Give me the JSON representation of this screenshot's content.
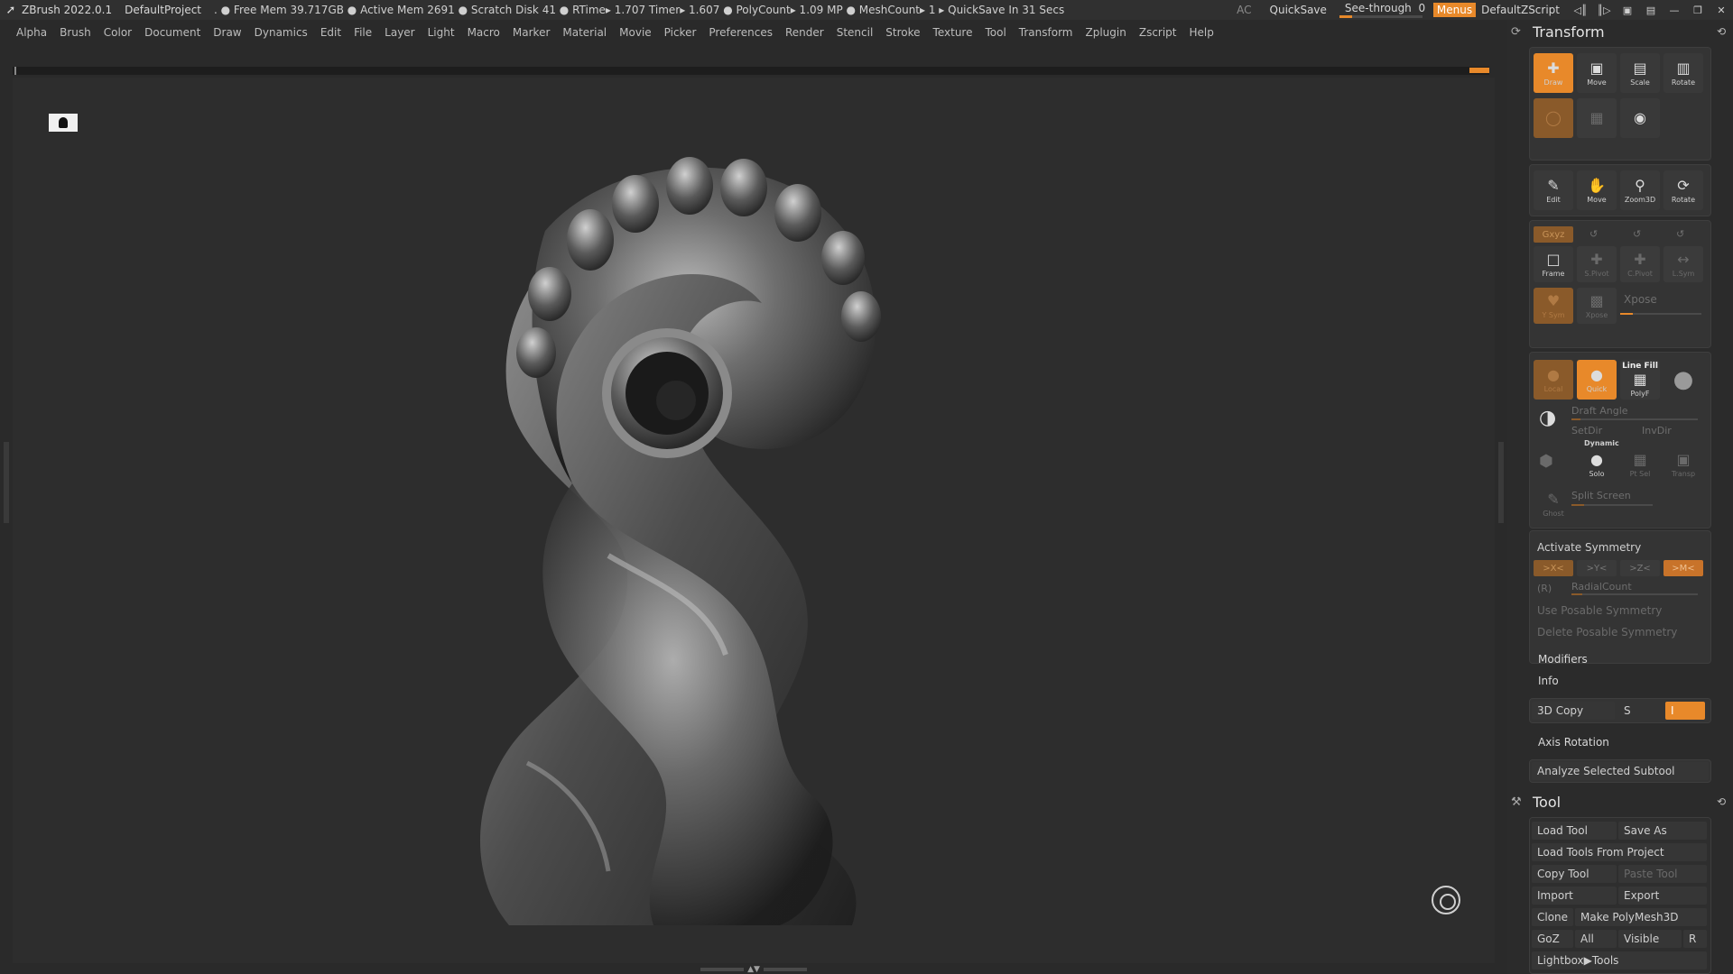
{
  "titlebar": {
    "app": "ZBrush 2022.0.1",
    "project": "DefaultProject",
    "stats": ". ● Free Mem 39.717GB ● Active Mem 2691 ● Scratch Disk 41 ●  RTime▸ 1.707 Timer▸ 1.607 ● PolyCount▸ 1.09 MP  ● MeshCount▸ 1  ▸ QuickSave In 31 Secs",
    "ac": "AC",
    "quicksave": "QuickSave",
    "seethrough_label": "See-through",
    "seethrough_value": "0",
    "seethrough_level": 0.15,
    "menus": "Menus",
    "script": "DefaultZScript"
  },
  "menubar": [
    "Alpha",
    "Brush",
    "Color",
    "Document",
    "Draw",
    "Dynamics",
    "Edit",
    "File",
    "Layer",
    "Light",
    "Macro",
    "Marker",
    "Material",
    "Movie",
    "Picker",
    "Preferences",
    "Render",
    "Stencil",
    "Stroke",
    "Texture",
    "Tool",
    "Transform",
    "Zplugin",
    "Zscript",
    "Help"
  ],
  "transform": {
    "title": "Transform",
    "modes": {
      "draw": "Draw",
      "move": "Move",
      "scale": "Scale",
      "rotate": "Rotate"
    },
    "nav": {
      "edit": "Edit",
      "move": "Move",
      "zoom3d": "Zoom3D",
      "rotate": "Rotate"
    },
    "xyz": "Gxyz",
    "frame": "Frame",
    "spivot": "S.Pivot",
    "cpivot": "C.Pivot",
    "lsym": "L.Sym",
    "ysym": "Y Sym",
    "xpose_btn": "Xpose",
    "xpose_label": "Xpose",
    "local": "Local",
    "quick": "Quick",
    "line_fill": "Line Fill",
    "polyf": "PolyF",
    "draft_angle": "Draft Angle",
    "setdir": "SetDir",
    "invdir": "InvDir",
    "dynamic": "Dynamic",
    "solo": "Solo",
    "ptsel": "Pt Sel",
    "transp": "Transp",
    "ghost": "Ghost",
    "split_screen": "Split Screen",
    "activate_symmetry": "Activate Symmetry",
    "sym_x": ">X<",
    "sym_y": ">Y<",
    "sym_z": ">Z<",
    "sym_m": ">M<",
    "r": "(R)",
    "radial_count": "RadialCount",
    "use_posable": "Use Posable Symmetry",
    "delete_posable": "Delete Posable Symmetry",
    "modifiers": "Modifiers",
    "info": "Info",
    "copy3d": "3D Copy",
    "s": "S",
    "i": "I",
    "axis_rotation": "Axis Rotation",
    "analyze": "Analyze Selected Subtool"
  },
  "tool": {
    "title": "Tool",
    "buttons": {
      "load": "Load Tool",
      "save_as": "Save As",
      "load_from_project": "Load Tools From Project",
      "copy": "Copy Tool",
      "paste": "Paste Tool",
      "import": "Import",
      "export": "Export",
      "clone": "Clone",
      "make_polymesh": "Make PolyMesh3D",
      "goz": "GoZ",
      "all": "All",
      "visible": "Visible",
      "r": "R",
      "lightbox": "Lightbox▶Tools"
    }
  },
  "colors": {
    "accent": "#e8892a",
    "bg": "#2a2a2a",
    "canvas": "#2d2d2d",
    "panel": "#2b2b2b"
  }
}
